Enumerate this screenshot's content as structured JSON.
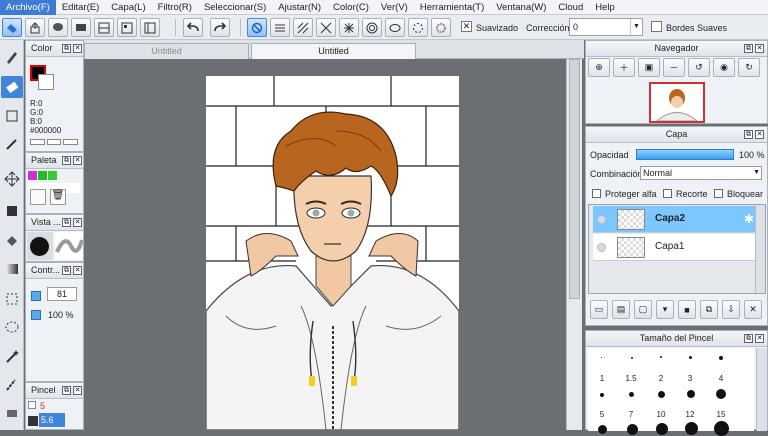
{
  "menu": [
    "Archivo(F)",
    "Editar(E)",
    "Capa(L)",
    "Filtro(R)",
    "Seleccionar(S)",
    "Ajustar(N)",
    "Color(C)",
    "Ver(V)",
    "Herramienta(T)",
    "Ventana(W)",
    "Cloud",
    "Help"
  ],
  "toolbar": {
    "smoothing_label": "Suavizado",
    "correction_label": "Corrección",
    "correction_value": "0",
    "soft_edges_label": "Bordes Suaves"
  },
  "color_panel": {
    "title": "Color",
    "r": "R:0",
    "g": "G:0",
    "b": "B:0",
    "hex": "#000000",
    "fg_color": "#000000"
  },
  "palette_panel": {
    "title": "Paleta",
    "swatches": [
      "#cc33cc",
      "#22bb22",
      "#33cc33"
    ]
  },
  "view_panel": {
    "title": "Vista ..."
  },
  "control_panel": {
    "title": "Contr...",
    "size_value": "81",
    "opacity_value": "100 %"
  },
  "brush_small_panel": {
    "title": "Pincel",
    "size1": "5",
    "size2": "5.6"
  },
  "canvas": {
    "tab_inactive": "Untitled",
    "tab_active": "Untitled"
  },
  "navigator": {
    "title": "Navegador"
  },
  "layers": {
    "title": "Capa",
    "opacity_label": "Opacidad",
    "opacity_value": "100 %",
    "blend_label": "Combinación",
    "blend_value": "Normal",
    "protect_alpha": "Proteger alfa",
    "clip": "Recorte",
    "lock": "Bloquear",
    "items": [
      {
        "name": "Capa2",
        "selected": true
      },
      {
        "name": "Capa1",
        "selected": false
      }
    ]
  },
  "brush_size": {
    "title": "Tamaño del Pincel",
    "row1": [
      "1",
      "1.5",
      "2",
      "3",
      "4"
    ],
    "row2": [
      "5",
      "7",
      "10",
      "12",
      "15"
    ]
  }
}
